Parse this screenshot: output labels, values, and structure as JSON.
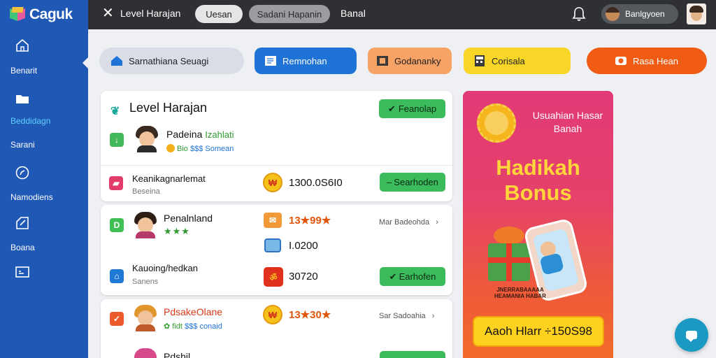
{
  "app": {
    "logo_text": "Caguk",
    "title": "Level Harajan"
  },
  "topbar": {
    "close_icon": "close-icon",
    "tabs": [
      {
        "label": "Uesan"
      },
      {
        "label": "Sadani Hapanin"
      }
    ],
    "link": "Banal",
    "bell_icon": "bell-icon",
    "user_name": "Banlgyoen"
  },
  "sidebar": {
    "items": [
      {
        "label": "Benarit",
        "icon": "home-icon"
      },
      {
        "label": "Beddidagn",
        "icon": "folder-icon",
        "active": true
      },
      {
        "label": "Sarani",
        "icon": ""
      },
      {
        "label": "Namodiens",
        "icon": "compass-icon"
      },
      {
        "label": "Boana",
        "icon": "edit-icon"
      },
      {
        "label": "",
        "icon": "card-icon"
      }
    ]
  },
  "actions": [
    {
      "label": "Sarnathiana Seuagi",
      "icon": "house-icon",
      "color": "#d9dde6"
    },
    {
      "label": "Remnohan",
      "icon": "document-icon",
      "color": "#1f73d6"
    },
    {
      "label": "Godananky",
      "icon": "film-icon",
      "color": "#f6a365"
    },
    {
      "label": "Corisala",
      "icon": "calculator-icon",
      "color": "#f7d628"
    },
    {
      "label": "Rasa Hean",
      "icon": "camera-icon",
      "color": "#f05c14"
    }
  ],
  "card1": {
    "title": "Level Harajan",
    "button": "Feanolap",
    "row1": {
      "name": "Padeina",
      "highlight": "Izahlati",
      "meta_green": "Bio",
      "meta_blue": "$$$ Somean"
    },
    "row2": {
      "name": "Keanikagnarlemat",
      "sub": "Beseina",
      "amount": "1300.0S6I0",
      "button": "Searhoden"
    }
  },
  "card2": {
    "row1": {
      "name": "Penalnland",
      "stars": "★★★",
      "amount": "13★99★",
      "link": "Mar Badeohda"
    },
    "row_mid": {
      "amount": "I.0200"
    },
    "row2": {
      "name": "Kauoing/hedkan",
      "sub": "Sanens",
      "amount": "30720",
      "button": "Earhofen"
    }
  },
  "card3": {
    "row1": {
      "name": "PdsakeOlane",
      "meta_green": "fidt",
      "meta_blue": "$$$ conaid",
      "amount": "13★30★",
      "link": "Sar Sadoahia"
    },
    "row2": {
      "name": "Pdshil"
    }
  },
  "promo": {
    "subtitle": "Usuahian Hasar Banah",
    "title": "Hadikah Bonus",
    "tiny": "JNERRABAAAAA HEAMANIA HABAR",
    "bar": "Aaoh Hlarr ÷150S98"
  },
  "chat": {
    "icon": "chat-icon"
  }
}
